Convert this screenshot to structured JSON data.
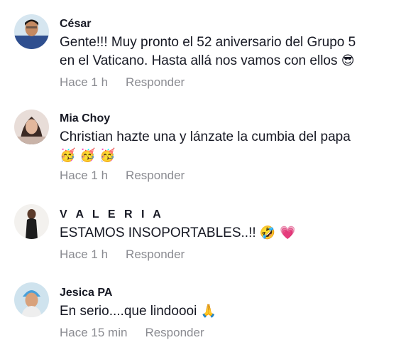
{
  "comments": [
    {
      "username": "César",
      "text_lines": [
        "Gente!!! Muy pronto el 52 aniversario del Grupo 5",
        "en el Vaticano. Hasta allá nos vamos con ellos"
      ],
      "emoji": "😎",
      "time": "Hace 1 h",
      "reply": "Responder"
    },
    {
      "username": "Mia Choy",
      "text_lines": [
        "Christian hazte una y lánzate la cumbia del papa"
      ],
      "emoji_line": "🥳 🥳 🥳",
      "time": "Hace 1 h",
      "reply": "Responder"
    },
    {
      "username": "V A L E R I A",
      "text": "ESTAMOS INSOPORTABLES..!!",
      "emoji": "🤣 💗",
      "time": "Hace 1 h",
      "reply": "Responder"
    },
    {
      "username": "Jesica PA",
      "text": "En serio....que lindoooi",
      "emoji": "🙏",
      "time": "Hace 15 min",
      "reply": "Responder"
    }
  ],
  "colors": {
    "text": "#161823",
    "meta": "#8a8b91"
  }
}
